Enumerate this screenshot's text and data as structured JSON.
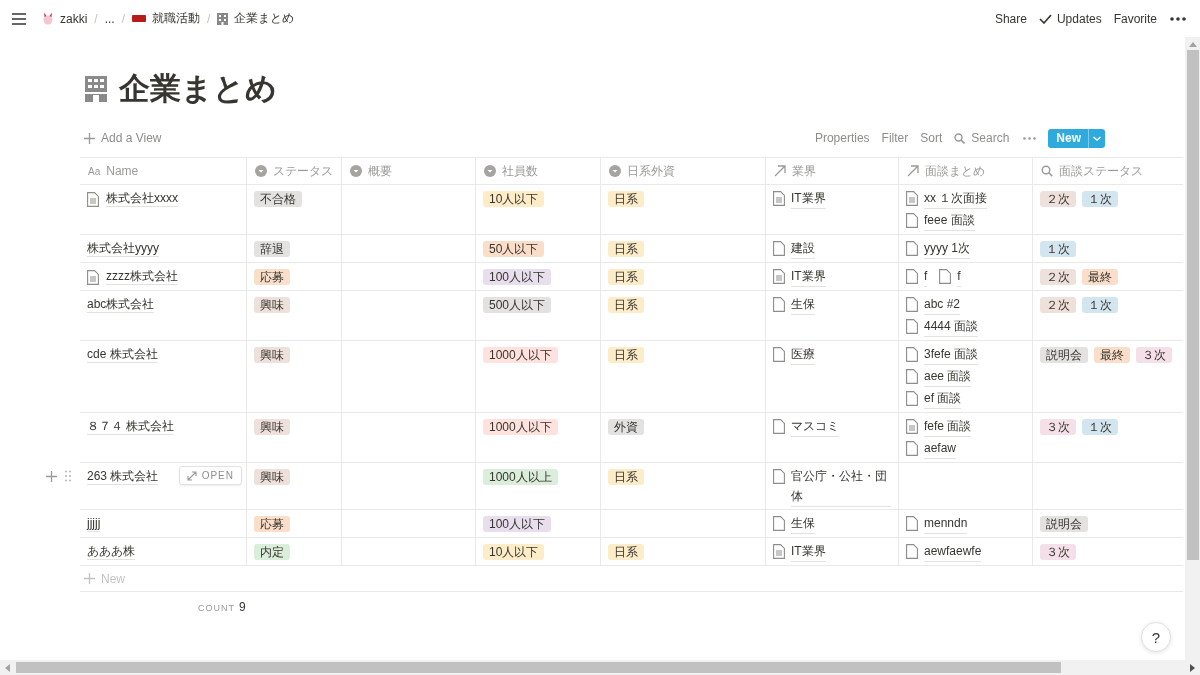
{
  "breadcrumbs": [
    {
      "label": "zakki"
    },
    {
      "label": "..."
    },
    {
      "label": "就職活動"
    },
    {
      "label": "企業まとめ"
    }
  ],
  "breadcrumb_separators": [
    "/",
    "/",
    "/"
  ],
  "top_actions": [
    {
      "label": "Share",
      "check": false
    },
    {
      "label": "Updates",
      "check": true
    },
    {
      "label": "Favorite",
      "check": false
    }
  ],
  "title": "企業まとめ",
  "add_view": "Add a View",
  "toolbar": [
    "Properties",
    "Filter",
    "Sort"
  ],
  "search": "Search",
  "new_button": "New",
  "columns": [
    {
      "label": "Name",
      "kind": "title",
      "glyph": "Aa"
    },
    {
      "label": "ステータス",
      "kind": "select"
    },
    {
      "label": "概要",
      "kind": "select"
    },
    {
      "label": "社員数",
      "kind": "select"
    },
    {
      "label": "日系外資",
      "kind": "select"
    },
    {
      "label": "業界",
      "kind": "relation"
    },
    {
      "label": "面談まとめ",
      "kind": "relation"
    },
    {
      "label": "面談ステータス",
      "kind": "rollup"
    }
  ],
  "rows": [
    {
      "name": "株式会社xxxx",
      "page_icon": true,
      "status": {
        "text": "不合格",
        "color": "#e3e2e0"
      },
      "size": {
        "text": "10人以下",
        "color": "#fdecc8"
      },
      "origin": {
        "text": "日系",
        "color": "#fdecc8"
      },
      "industry": [
        {
          "title": "IT業界",
          "kind": "filled"
        }
      ],
      "interviews": [
        {
          "title": "xx １次面接",
          "kind": "filled"
        },
        {
          "title": "feee 面談",
          "kind": "blank"
        }
      ],
      "interview_status": [
        {
          "text": "２次",
          "color": "#eee0da"
        },
        {
          "text": "１次",
          "color": "#d3e5ef"
        }
      ]
    },
    {
      "name": "株式会社yyyy",
      "page_icon": false,
      "status": {
        "text": "辞退",
        "color": "#e3e2e0"
      },
      "size": {
        "text": "50人以下",
        "color": "#fadec9"
      },
      "origin": {
        "text": "日系",
        "color": "#fdecc8"
      },
      "industry": [
        {
          "title": "建設",
          "kind": "blank"
        }
      ],
      "interviews": [
        {
          "title": "yyyy 1次",
          "kind": "blank"
        }
      ],
      "interview_status": [
        {
          "text": "１次",
          "color": "#d3e5ef"
        }
      ]
    },
    {
      "name": "zzzz株式会社",
      "page_icon": true,
      "status": {
        "text": "応募",
        "color": "#fadec9"
      },
      "size": {
        "text": "100人以下",
        "color": "#e8deee"
      },
      "origin": {
        "text": "日系",
        "color": "#fdecc8"
      },
      "industry": [
        {
          "title": "IT業界",
          "kind": "filled"
        }
      ],
      "interviews": [
        {
          "title": "f",
          "kind": "blank"
        },
        {
          "title": "f",
          "kind": "blank"
        }
      ],
      "interview_status": [
        {
          "text": "２次",
          "color": "#eee0da"
        },
        {
          "text": "最終",
          "color": "#fadec9"
        }
      ]
    },
    {
      "name": "abc株式会社",
      "page_icon": false,
      "status": {
        "text": "興味",
        "color": "#eee0da"
      },
      "size": {
        "text": "500人以下",
        "color": "#e3e2e0"
      },
      "origin": {
        "text": "日系",
        "color": "#fdecc8"
      },
      "industry": [
        {
          "title": "生保",
          "kind": "blank"
        }
      ],
      "interviews": [
        {
          "title": "abc #2",
          "kind": "blank"
        },
        {
          "title": "4444 面談",
          "kind": "blank"
        }
      ],
      "interview_status": [
        {
          "text": "２次",
          "color": "#eee0da"
        },
        {
          "text": "１次",
          "color": "#d3e5ef"
        }
      ]
    },
    {
      "name": "cde 株式会社",
      "page_icon": false,
      "status": {
        "text": "興味",
        "color": "#eee0da"
      },
      "size": {
        "text": "1000人以下",
        "color": "#ffe2dd"
      },
      "origin": {
        "text": "日系",
        "color": "#fdecc8"
      },
      "industry": [
        {
          "title": "医療",
          "kind": "blank"
        }
      ],
      "interviews": [
        {
          "title": "3fefe 面談",
          "kind": "blank"
        },
        {
          "title": "aee 面談",
          "kind": "blank"
        },
        {
          "title": "ef 面談",
          "kind": "blank"
        }
      ],
      "interview_status": [
        {
          "text": "説明会",
          "color": "#e3e2e0"
        },
        {
          "text": "最終",
          "color": "#fadec9"
        },
        {
          "text": "３次",
          "color": "#f5e0e9"
        }
      ]
    },
    {
      "name": "８７４ 株式会社",
      "page_icon": false,
      "status": {
        "text": "興味",
        "color": "#eee0da"
      },
      "size": {
        "text": "1000人以下",
        "color": "#ffe2dd"
      },
      "origin": {
        "text": "外資",
        "color": "#e3e2e0"
      },
      "industry": [
        {
          "title": "マスコミ",
          "kind": "blank"
        }
      ],
      "interviews": [
        {
          "title": "fefe 面談",
          "kind": "filled"
        },
        {
          "title": "aefaw",
          "kind": "blank"
        }
      ],
      "interview_status": [
        {
          "text": "３次",
          "color": "#f5e0e9"
        },
        {
          "text": "１次",
          "color": "#d3e5ef"
        }
      ]
    },
    {
      "name": "263 株式会社",
      "page_icon": false,
      "open_label": "OPEN",
      "status": {
        "text": "興味",
        "color": "#eee0da"
      },
      "size": {
        "text": "1000人以上",
        "color": "#dbeddb"
      },
      "origin": {
        "text": "日系",
        "color": "#fdecc8"
      },
      "industry": [
        {
          "title": "官公庁・公社・団体",
          "kind": "blank"
        }
      ],
      "interviews": [],
      "interview_status": []
    },
    {
      "name": "jjjjj",
      "page_icon": false,
      "status": {
        "text": "応募",
        "color": "#fadec9"
      },
      "size": {
        "text": "100人以下",
        "color": "#e8deee"
      },
      "industry": [
        {
          "title": "生保",
          "kind": "blank"
        }
      ],
      "interviews": [
        {
          "title": "menndn",
          "kind": "blank"
        }
      ],
      "interview_status": [
        {
          "text": "説明会",
          "color": "#e3e2e0"
        }
      ]
    },
    {
      "name": "あああ株",
      "page_icon": false,
      "status": {
        "text": "内定",
        "color": "#dbeddb"
      },
      "size": {
        "text": "10人以下",
        "color": "#fdecc8"
      },
      "origin": {
        "text": "日系",
        "color": "#fdecc8"
      },
      "industry": [
        {
          "title": "IT業界",
          "kind": "filled"
        }
      ],
      "interviews": [
        {
          "title": "aewfaewfe",
          "kind": "blank"
        }
      ],
      "interview_status": [
        {
          "text": "３次",
          "color": "#f5e0e9"
        }
      ]
    }
  ],
  "new_row": "New",
  "count_label": "COUNT",
  "count": "9",
  "help": "?"
}
